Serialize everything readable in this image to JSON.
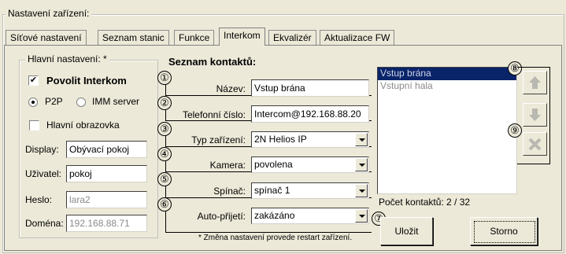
{
  "window": {
    "group_title": "Nastavení zařízení:"
  },
  "tabs": [
    {
      "label": "Síťové nastavení"
    },
    {
      "label": "Seznam stanic"
    },
    {
      "label": "Funkce"
    },
    {
      "label": "Interkom",
      "active": true
    },
    {
      "label": "Ekvalizér"
    },
    {
      "label": "Aktualizace FW"
    }
  ],
  "main_settings": {
    "title": "Hlavní nastavení: *",
    "enable_intercom": {
      "label": "Povolit Interkom",
      "checked": true
    },
    "radio_p2p": {
      "label": "P2P",
      "selected": true
    },
    "radio_imm": {
      "label": "IMM server",
      "selected": false
    },
    "main_screen": {
      "label": "Hlavní obrazovka",
      "checked": false
    },
    "display_label": "Display:",
    "display_value": "Obývací pokoj",
    "user_label": "Uživatel:",
    "user_value": "pokoj",
    "password_label": "Heslo:",
    "password_value": "lara2",
    "domain_label": "Doména:",
    "domain_value": "192.168.88.71"
  },
  "contacts": {
    "title": "Seznam kontaktů:",
    "name_label": "Název:",
    "name_value": "Vstup brána",
    "phone_label": "Telefonní číslo:",
    "phone_value": "Intercom@192.168.88.20",
    "device_type_label": "Typ zařízení:",
    "device_type_value": "2N Helios IP",
    "camera_label": "Kamera:",
    "camera_value": "povolena",
    "switch_label": "Spínač:",
    "switch_value": "spínač 1",
    "auto_answer_label": "Auto-přijetí:",
    "auto_answer_value": "zakázáno",
    "note": "* Změna nastavení provede restart zařízení.",
    "list_items": [
      "Vstup brána",
      "Vstupní hala"
    ],
    "count_text": "Počet kontaktů: 2 / 32",
    "save_label": "Uložit",
    "cancel_label": "Storno"
  },
  "markers": [
    "①",
    "②",
    "③",
    "④",
    "⑤",
    "⑥",
    "⑦",
    "⑧",
    "⑨"
  ],
  "colors": {
    "background": "#ece9d8",
    "selection": "#0a246a",
    "disabled_icon": "#b8b8b0"
  }
}
